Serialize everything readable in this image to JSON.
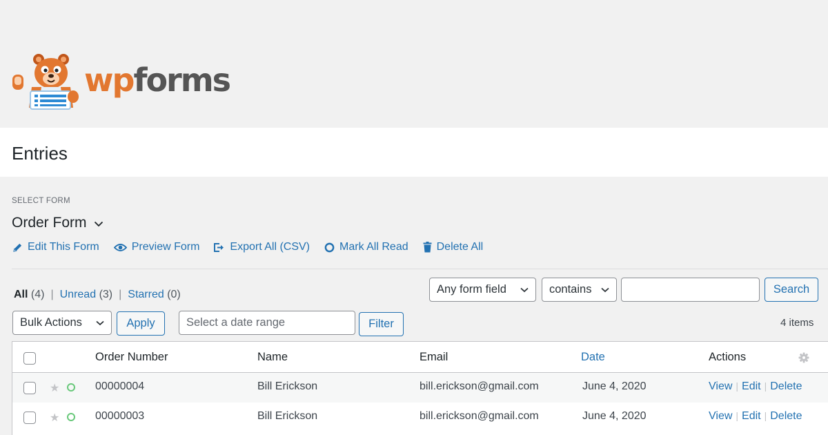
{
  "brand": {
    "name_part1": "wp",
    "name_part2": "forms",
    "mascot": "bear-mascot-icon"
  },
  "page": {
    "title": "Entries"
  },
  "form_selector": {
    "label": "SELECT FORM",
    "value": "Order Form"
  },
  "form_actions": [
    {
      "label": "Edit This Form",
      "icon": "pencil-icon"
    },
    {
      "label": "Preview Form",
      "icon": "eye-icon"
    },
    {
      "label": "Export All (CSV)",
      "icon": "export-icon"
    },
    {
      "label": "Mark All Read",
      "icon": "circle-icon"
    },
    {
      "label": "Delete All",
      "icon": "trash-icon"
    }
  ],
  "views": [
    {
      "label": "All",
      "count": "(4)",
      "current": true
    },
    {
      "label": "Unread",
      "count": "(3)"
    },
    {
      "label": "Starred",
      "count": "(0)"
    }
  ],
  "search": {
    "field_select": "Any form field",
    "operator_select": "contains",
    "input_value": "",
    "button": "Search"
  },
  "bulk": {
    "select": "Bulk Actions",
    "apply": "Apply",
    "date_placeholder": "Select a date range",
    "filter": "Filter",
    "items_count": "4 items"
  },
  "table": {
    "columns": [
      "Order Number",
      "Name",
      "Email",
      "Date",
      "Actions"
    ],
    "rows": [
      {
        "order": "00000004",
        "name": "Bill Erickson",
        "email": "bill.erickson@gmail.com",
        "date": "June 4, 2020"
      },
      {
        "order": "00000003",
        "name": "Bill Erickson",
        "email": "bill.erickson@gmail.com",
        "date": "June 4, 2020"
      }
    ],
    "row_actions": {
      "view": "View",
      "edit": "Edit",
      "delete": "Delete"
    }
  },
  "colors": {
    "accent": "#2271b1",
    "brand_orange": "#e27730",
    "unread": "#68c87a"
  }
}
